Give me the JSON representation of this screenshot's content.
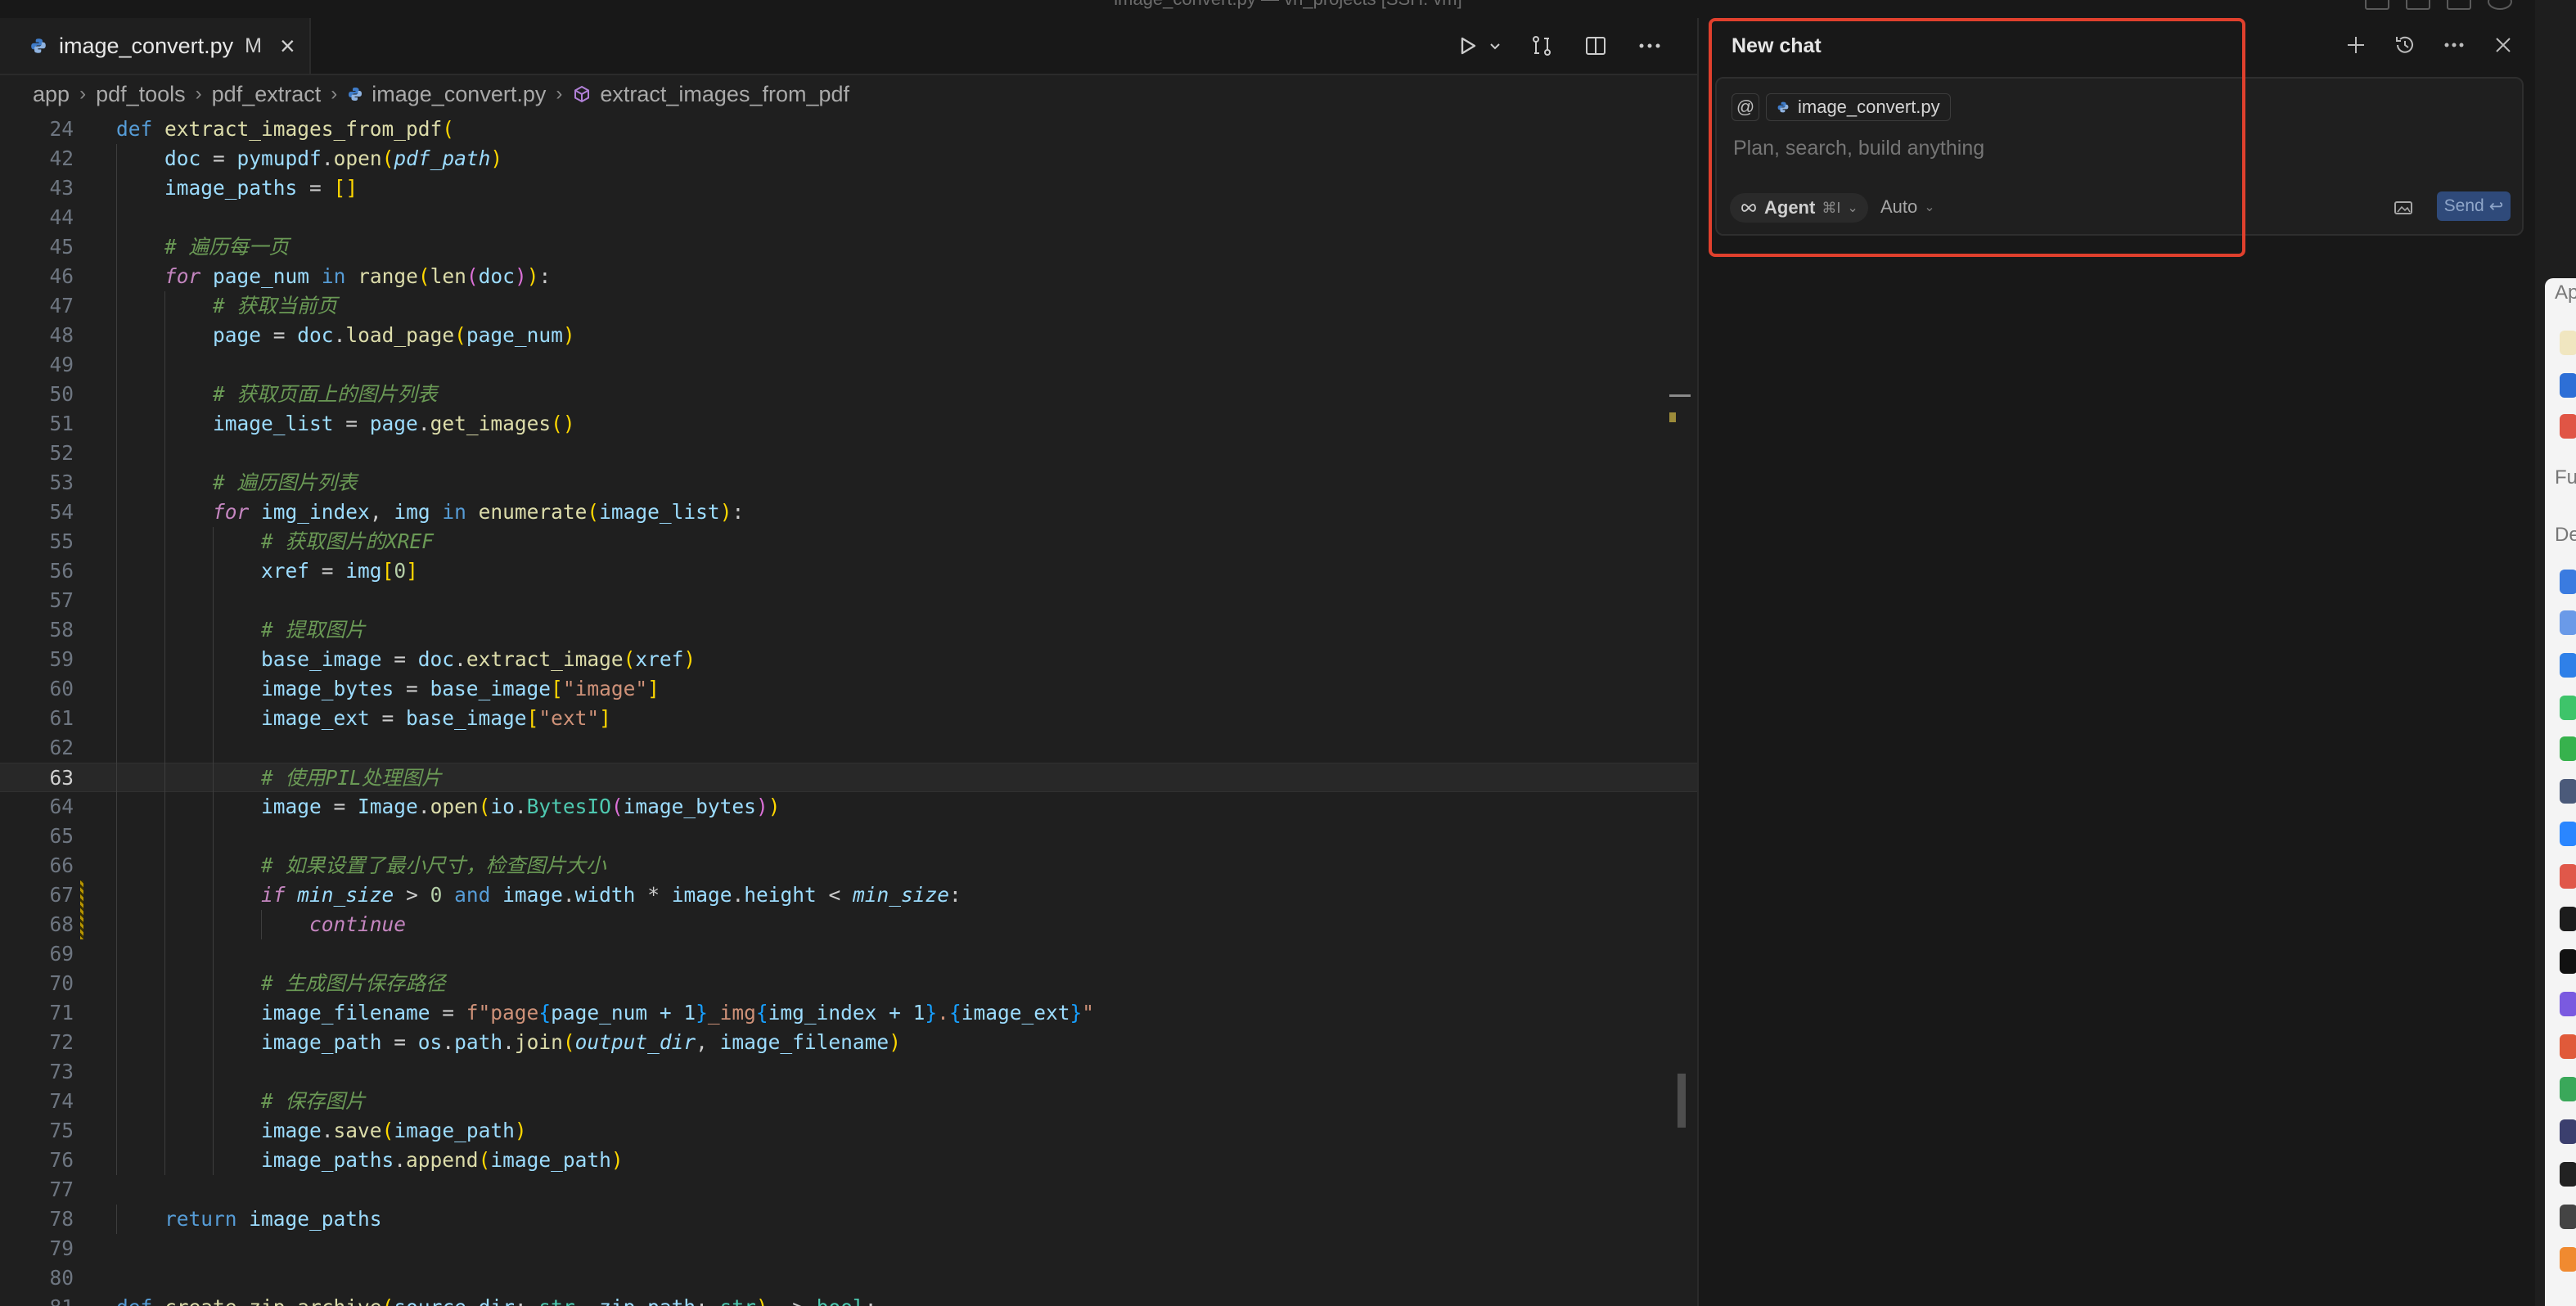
{
  "window": {
    "title": "image_convert.py — vn_projects [SSH: vm]"
  },
  "editor": {
    "tab": {
      "filename": "image_convert.py",
      "status": "M"
    },
    "toolbar_icons": [
      "run-icon",
      "chevron-down-icon",
      "compare-changes-icon",
      "split-editor-icon",
      "more-icon"
    ],
    "breadcrumb": [
      "app",
      "pdf_tools",
      "pdf_extract",
      "image_convert.py",
      "extract_images_from_pdf"
    ],
    "line_numbers": [
      "24",
      "42",
      "43",
      "44",
      "45",
      "46",
      "47",
      "48",
      "49",
      "50",
      "51",
      "52",
      "53",
      "54",
      "55",
      "56",
      "57",
      "58",
      "59",
      "60",
      "61",
      "62",
      "63",
      "64",
      "65",
      "66",
      "67",
      "68",
      "69",
      "70",
      "71",
      "72",
      "73",
      "74",
      "75",
      "76",
      "77",
      "78",
      "79",
      "80",
      "81"
    ],
    "current_line": "63",
    "code_lines": [
      "def extract_images_from_pdf(",
      "    doc = pymupdf.open(pdf_path)",
      "    image_paths = []",
      "",
      "    # 遍历每一页",
      "    for page_num in range(len(doc)):",
      "        # 获取当前页",
      "        page = doc.load_page(page_num)",
      "",
      "        # 获取页面上的图片列表",
      "        image_list = page.get_images()",
      "",
      "        # 遍历图片列表",
      "        for img_index, img in enumerate(image_list):",
      "            # 获取图片的XREF",
      "            xref = img[0]",
      "",
      "            # 提取图片",
      "            base_image = doc.extract_image(xref)",
      "            image_bytes = base_image[\"image\"]",
      "            image_ext = base_image[\"ext\"]",
      "",
      "            # 使用PIL处理图片",
      "            image = Image.open(io.BytesIO(image_bytes))",
      "",
      "            # 如果设置了最小尺寸，检查图片大小",
      "            if min_size > 0 and image.width * image.height < min_size:",
      "                continue",
      "",
      "            # 生成图片保存路径",
      "            image_filename = f\"page{page_num + 1}_img{img_index + 1}.{image_ext}\"",
      "            image_path = os.path.join(output_dir, image_filename)",
      "",
      "            # 保存图片",
      "            image.save(image_path)",
      "            image_paths.append(image_path)",
      "",
      "    return image_paths",
      "",
      "",
      "def create_zip_archive(source_dir: str, zip_path: str) -> bool:"
    ]
  },
  "chat": {
    "title": "New chat",
    "header_icons": [
      "plus-icon",
      "history-icon",
      "more-icon",
      "close-icon"
    ],
    "at_symbol": "@",
    "context_file": "image_convert.py",
    "input_placeholder": "Plan, search, build anything",
    "mode": {
      "label": "Agent",
      "shortcut": "⌘I",
      "icon": "infinity-icon"
    },
    "model": "Auto",
    "send_label": "Send",
    "send_shortcut": "↩"
  },
  "colors": {
    "highlight_box": "#e0402d",
    "editor_bg": "#1f1f1f",
    "panel_bg": "#181818",
    "send_button": "#2f4a7a"
  },
  "side_window_fragments": [
    "Ap",
    "Fu",
    "De"
  ]
}
